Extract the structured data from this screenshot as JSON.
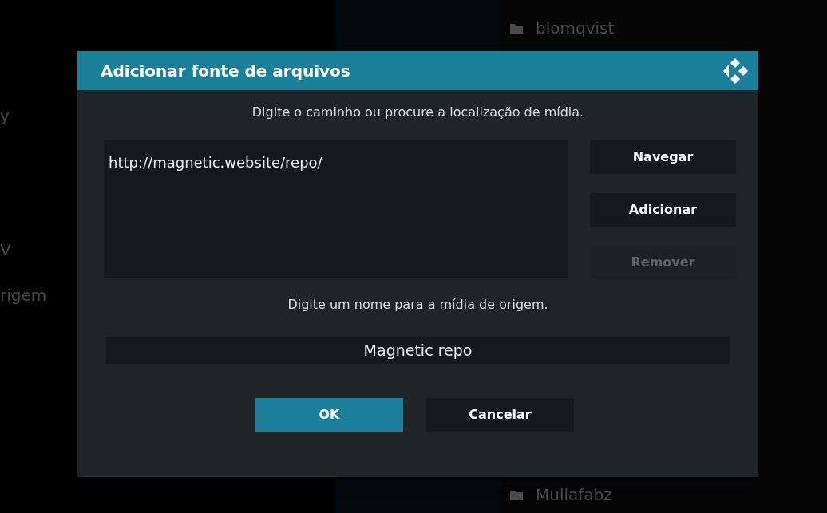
{
  "background": {
    "left_items": [
      {
        "label": "y"
      },
      {
        "label": "V"
      },
      {
        "label": "rigem"
      }
    ],
    "right_items": [
      {
        "label": "blomqvist"
      },
      {
        "label": "Mullafabz"
      }
    ]
  },
  "dialog": {
    "title": "Adicionar fonte de arquivos",
    "path_prompt": "Digite o caminho ou procure a localização de mídia.",
    "path_value": "http://magnetic.website/repo/",
    "side_buttons": [
      {
        "label": "Navegar",
        "disabled": false
      },
      {
        "label": "Adicionar",
        "disabled": false
      },
      {
        "label": "Remover",
        "disabled": true
      }
    ],
    "name_prompt": "Digite um nome para a mídia de origem.",
    "name_value": "Magnetic repo",
    "buttons": [
      {
        "label": "OK",
        "selected": true
      },
      {
        "label": "Cancelar",
        "selected": false
      }
    ]
  }
}
